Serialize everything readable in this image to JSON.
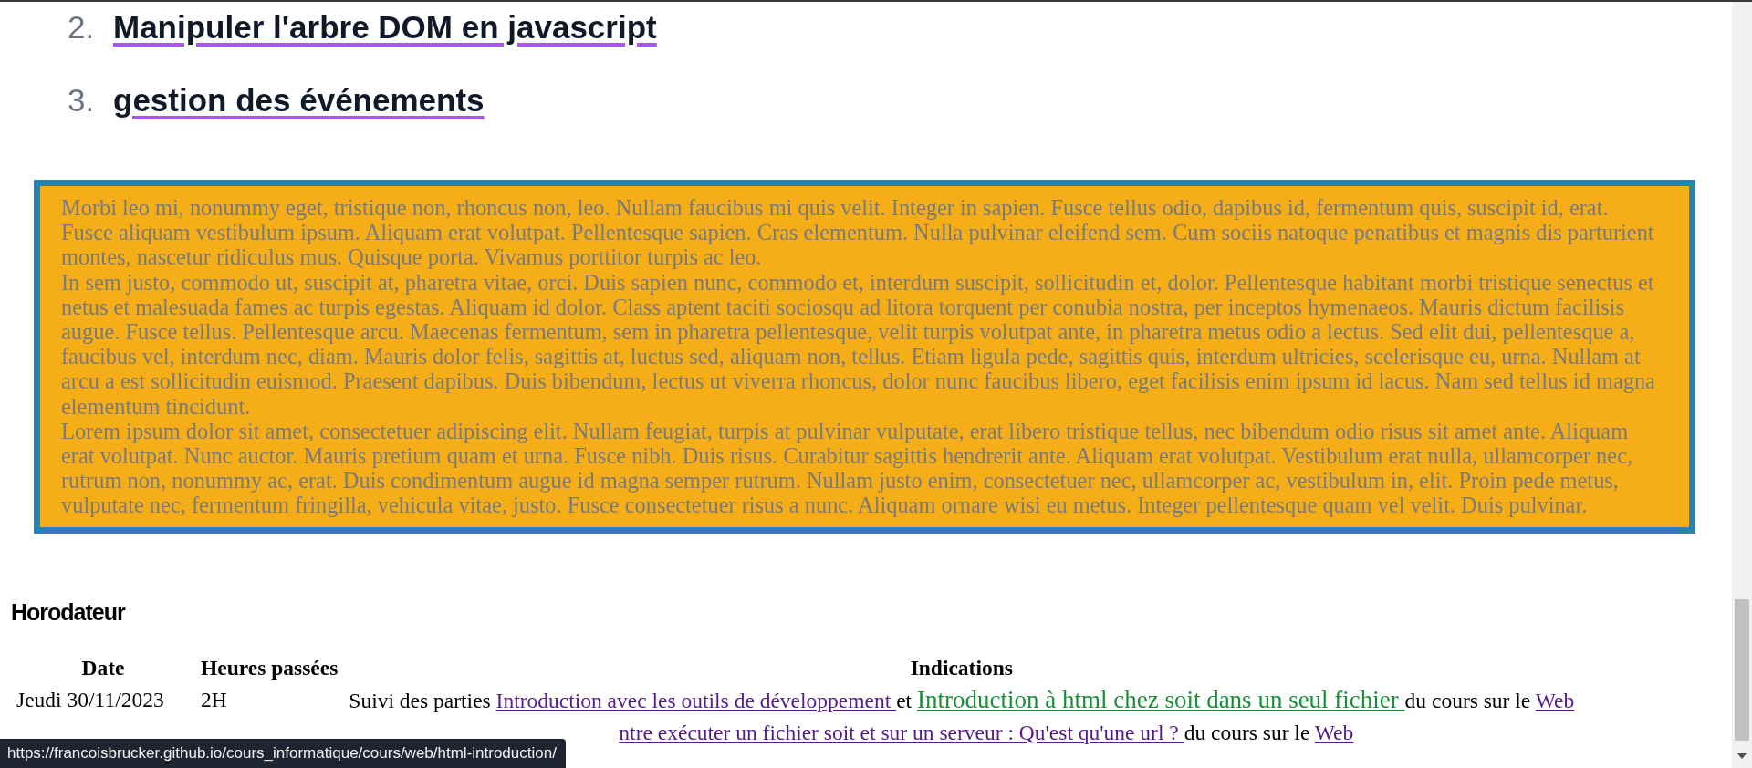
{
  "chapter_list": [
    {
      "number": "2.",
      "text": "Manipuler l'arbre DOM en javascript"
    },
    {
      "number": "3.",
      "text": "gestion des événements"
    }
  ],
  "text_box": {
    "paragraphs": [
      "Morbi leo mi, nonummy eget, tristique non, rhoncus non, leo. Nullam faucibus mi quis velit. Integer in sapien. Fusce tellus odio, dapibus id, fermentum quis, suscipit id, erat. Fusce aliquam vestibulum ipsum. Aliquam erat volutpat. Pellentesque sapien. Cras elementum. Nulla pulvinar eleifend sem. Cum sociis natoque penatibus et magnis dis parturient montes, nascetur ridiculus mus. Quisque porta. Vivamus porttitor turpis ac leo.",
      "In sem justo, commodo ut, suscipit at, pharetra vitae, orci. Duis sapien nunc, commodo et, interdum suscipit, sollicitudin et, dolor. Pellentesque habitant morbi tristique senectus et netus et malesuada fames ac turpis egestas. Aliquam id dolor. Class aptent taciti sociosqu ad litora torquent per conubia nostra, per inceptos hymenaeos. Mauris dictum facilisis augue. Fusce tellus. Pellentesque arcu. Maecenas fermentum, sem in pharetra pellentesque, velit turpis volutpat ante, in pharetra metus odio a lectus. Sed elit dui, pellentesque a, faucibus vel, interdum nec, diam. Mauris dolor felis, sagittis at, luctus sed, aliquam non, tellus. Etiam ligula pede, sagittis quis, interdum ultricies, scelerisque eu, urna. Nullam at arcu a est sollicitudin euismod. Praesent dapibus. Duis bibendum, lectus ut viverra rhoncus, dolor nunc faucibus libero, eget facilisis enim ipsum id lacus. Nam sed tellus id magna elementum tincidunt.",
      "Lorem ipsum dolor sit amet, consectetuer adipiscing elit. Nullam feugiat, turpis at pulvinar vulputate, erat libero tristique tellus, nec bibendum odio risus sit amet ante. Aliquam erat volutpat. Nunc auctor. Mauris pretium quam et urna. Fusce nibh. Duis risus. Curabitur sagittis hendrerit ante. Aliquam erat volutpat. Vestibulum erat nulla, ullamcorper nec, rutrum non, nonummy ac, erat. Duis condimentum augue id magna semper rutrum. Nullam justo enim, consectetuer nec, ullamcorper ac, vestibulum in, elit. Proin pede metus, vulputate nec, fermentum fringilla, vehicula vitae, justo. Fusce consectetuer risus a nunc. Aliquam ornare wisi eu metus. Integer pellentesque quam vel velit. Duis pulvinar."
    ]
  },
  "timesheet": {
    "title": "Horodateur",
    "columns": [
      "Date",
      "Heures passées",
      "Indications"
    ],
    "rows": [
      {
        "date": "Jeudi 30/11/2023",
        "hours": "2H",
        "indications": [
          {
            "kind": "text",
            "text": "Suivi des parties "
          },
          {
            "kind": "link",
            "text": "Introduction avec les outils de développement ",
            "color": "#551a8b"
          },
          {
            "kind": "text",
            "text": " et "
          },
          {
            "kind": "link",
            "text": "Introduction à html chez soit dans un seul fichier ",
            "color": "#1a8f3a"
          },
          {
            "kind": "text",
            "text": " du cours sur le "
          },
          {
            "kind": "link",
            "text": "Web",
            "color": "#551a8b"
          }
        ]
      },
      {
        "indications": [
          {
            "kind": "link",
            "text": "ntre exécuter un fichier soit et sur un serveur : Qu'est qu'une url ? ",
            "color": "#551a8b"
          },
          {
            "kind": "text",
            "text": " du cours sur le "
          },
          {
            "kind": "link",
            "text": "Web",
            "color": "#551a8b"
          }
        ]
      }
    ]
  },
  "status_tooltip": {
    "url": "https://francoisbrucker.github.io/cours_informatique/cours/web/html-introduction/"
  }
}
